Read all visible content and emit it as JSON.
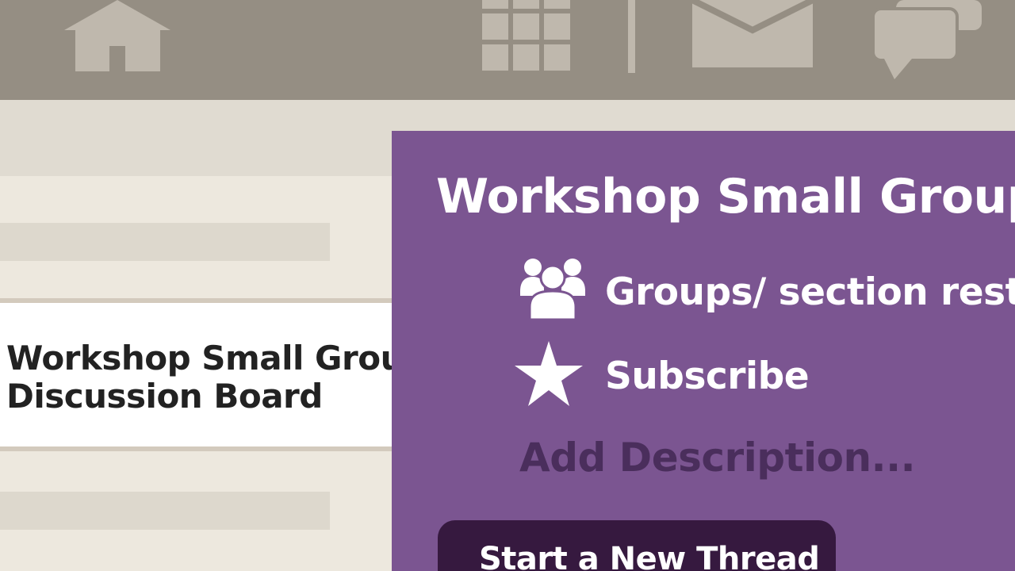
{
  "toolbar": {
    "icons": [
      "home-icon",
      "grid-icon",
      "mail-icon",
      "chat-icon"
    ]
  },
  "sidebar": {
    "card_title": "Workshop Small Groups\nDiscussion Board"
  },
  "panel": {
    "title": "Workshop Small Groups",
    "groups_label": "Groups/ section restrictions",
    "subscribe_label": "Subscribe",
    "description_placeholder": "Add Description...",
    "new_thread_label": "Start a New Thread"
  },
  "colors": {
    "accent_purple": "#7b5591",
    "button_dark": "#36193f",
    "toolbar": "#958e83"
  }
}
